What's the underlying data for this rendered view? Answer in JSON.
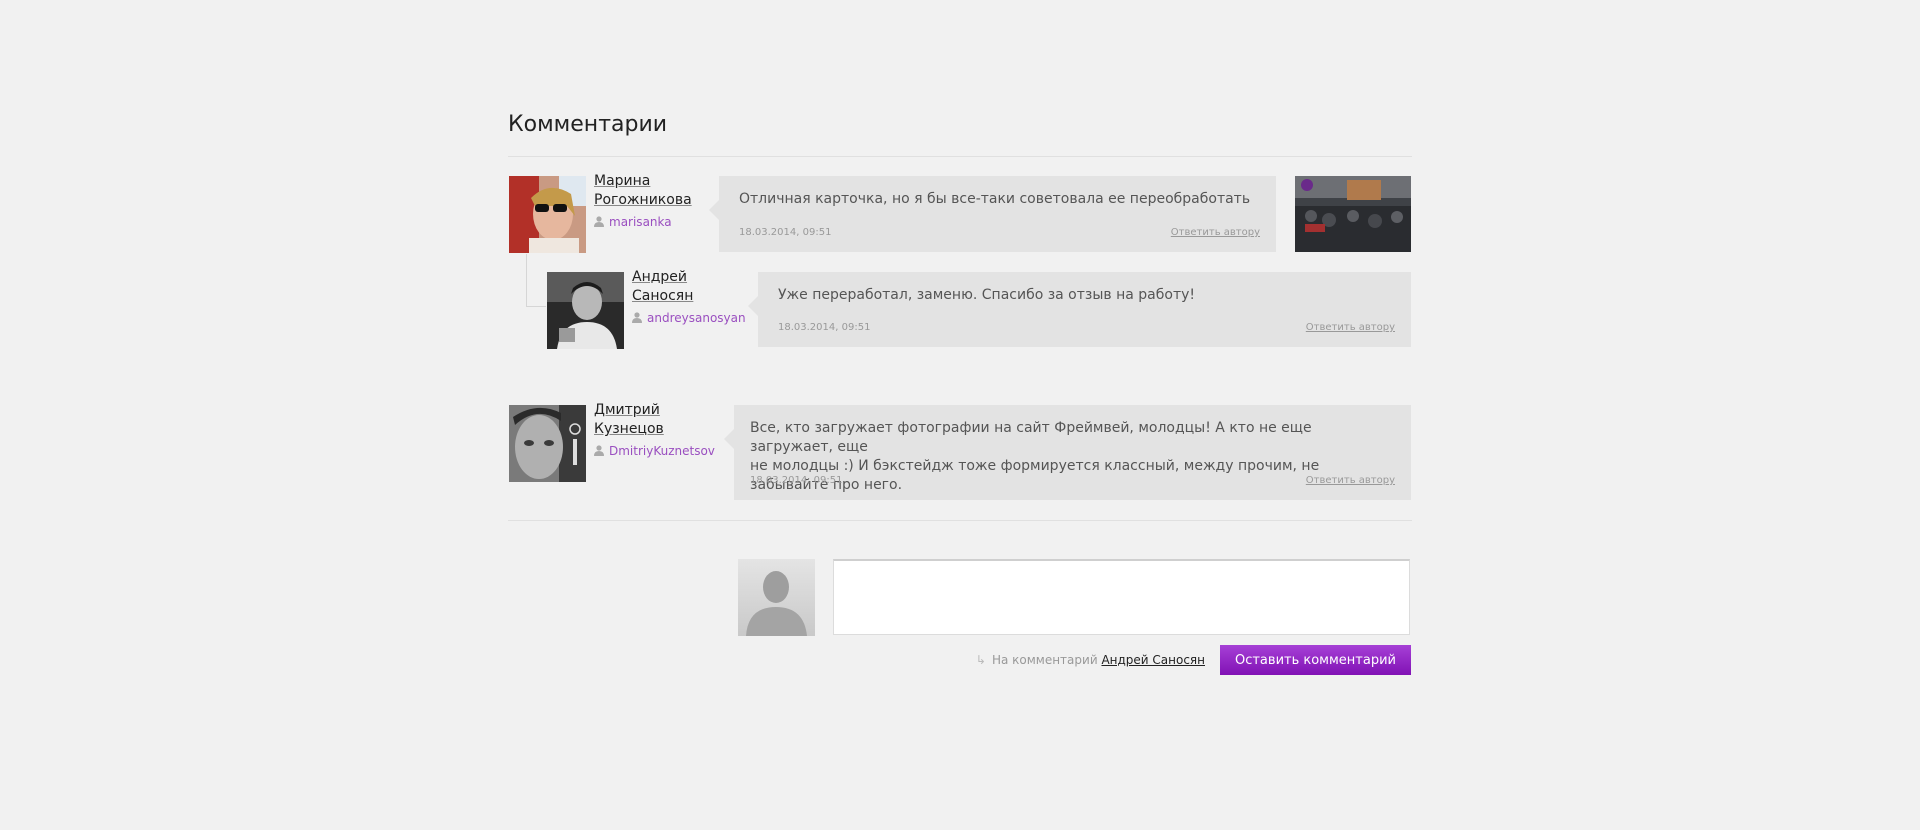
{
  "section": {
    "title": "Комментарии"
  },
  "comments": [
    {
      "name_line1": "Марина",
      "name_line2": "Рогожникова",
      "login": "marisanka",
      "text": "Отличная карточка, но я бы все-таки советовала ее переобработать",
      "date": "18.03.2014, 09:51",
      "reply_label": "Ответить автору"
    },
    {
      "name_line1": "Андрей",
      "name_line2": "Саносян",
      "login": "andreysanosyan",
      "text": "Уже переработал, заменю. Спасибо за отзыв на работу!",
      "date": "18.03.2014, 09:51",
      "reply_label": "Ответить автору"
    },
    {
      "name_line1": "Дмитрий",
      "name_line2": "Кузнецов",
      "login": "DmitriyKuznetsov",
      "text_line1": "Все, кто загружает фотографии на сайт Фреймвей, молодцы! А кто не еще загружает, еще",
      "text_line2": "не молодцы :) И бэкстейдж тоже формируется классный, между прочим, не забывайте про него.",
      "date": "18.03.2014, 09:51",
      "reply_label": "Ответить автору"
    }
  ],
  "form": {
    "comment_value": "",
    "reply_prefix": "На комментарий",
    "reply_target": "Андрей Саносян",
    "submit_label": "Оставить комментарий"
  },
  "colors": {
    "accent": "#8e1fc2",
    "login": "#9a4fc0",
    "bubble": "#e3e3e3",
    "background": "#f1f1f1"
  }
}
